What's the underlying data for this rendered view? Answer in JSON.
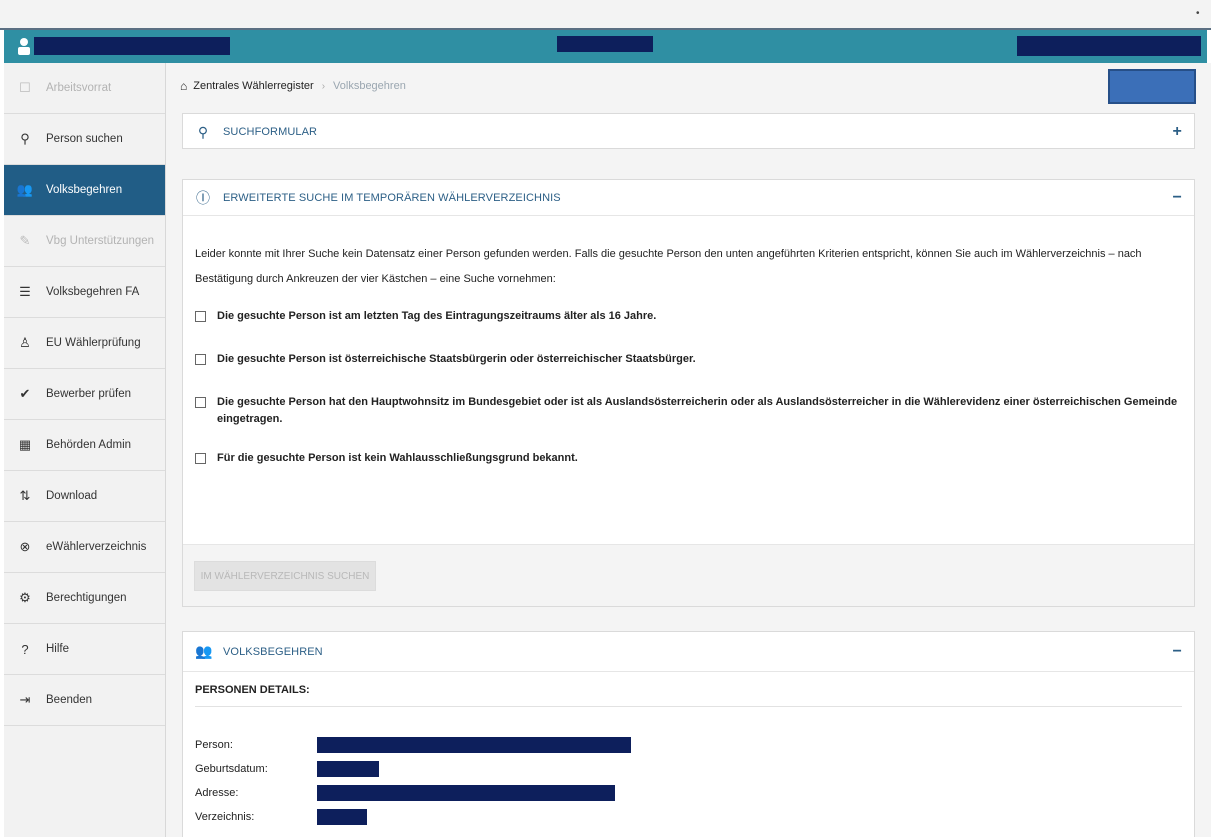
{
  "sidebar": {
    "items": [
      {
        "label": "Arbeitsvorrat",
        "icon": "inbox-icon",
        "glyph": "☐",
        "state": "disabled"
      },
      {
        "label": "Person suchen",
        "icon": "search-icon",
        "glyph": "⚲",
        "state": "normal"
      },
      {
        "label": "Volksbegehren",
        "icon": "petition-icon",
        "glyph": "👥",
        "state": "active"
      },
      {
        "label": "Vbg Unterstützungen",
        "icon": "pencil-icon",
        "glyph": "✎",
        "state": "disabled"
      },
      {
        "label": "Volksbegehren FA",
        "icon": "list-icon",
        "glyph": "☰",
        "state": "normal"
      },
      {
        "label": "EU Wählerprüfung",
        "icon": "person-icon",
        "glyph": "♙",
        "state": "normal"
      },
      {
        "label": "Bewerber prüfen",
        "icon": "check-circle-icon",
        "glyph": "✔",
        "state": "normal"
      },
      {
        "label": "Behörden Admin",
        "icon": "building-icon",
        "glyph": "▦",
        "state": "normal"
      },
      {
        "label": "Download",
        "icon": "download-icon",
        "glyph": "⇅",
        "state": "normal"
      },
      {
        "label": "eWählerverzeichnis",
        "icon": "cancel-circle-icon",
        "glyph": "⊗",
        "state": "normal"
      },
      {
        "label": "Berechtigungen",
        "icon": "gear-icon",
        "glyph": "⚙",
        "state": "normal"
      },
      {
        "label": "Hilfe",
        "icon": "help-icon",
        "glyph": "?",
        "state": "normal"
      },
      {
        "label": "Beenden",
        "icon": "exit-icon",
        "glyph": "⇥",
        "state": "normal"
      }
    ]
  },
  "breadcrumb": {
    "home": "Zentrales Wählerregister",
    "current": "Volksbegehren"
  },
  "search_panel": {
    "title": "SUCHFORMULAR",
    "toggle": "+"
  },
  "extended_panel": {
    "title": "ERWEITERTE SUCHE IM TEMPORÄREN WÄHLERVERZEICHNIS",
    "toggle": "−",
    "info_text": "Leider konnte mit Ihrer Suche kein Datensatz einer Person gefunden werden. Falls die gesuchte Person den unten angeführten Kriterien entspricht, können Sie auch im Wählerverzeichnis – nach Bestätigung durch Ankreuzen der vier Kästchen – eine Suche vornehmen:",
    "checkboxes": [
      "Die gesuchte Person ist am letzten Tag des Eintragungszeitraums älter als 16 Jahre.",
      "Die gesuchte Person ist österreichische Staatsbürgerin oder österreichischer Staatsbürger.",
      "Die gesuchte Person hat den Hauptwohnsitz im Bundesgebiet oder ist als Auslandsösterreicherin oder als Auslandsösterreicher in die Wählerevidenz einer österreichischen Gemeinde eingetragen.",
      "Für die gesuchte Person ist kein Wahlausschließungsgrund bekannt."
    ],
    "search_button": "IM WÄHLERVERZEICHNIS SUCHEN"
  },
  "volksbegehren_panel": {
    "title": "VOLKSBEGEHREN",
    "toggle": "−",
    "section_title": "PERSONEN DETAILS:",
    "labels": {
      "person": "Person:",
      "birthdate": "Geburtsdatum:",
      "address": "Adresse:",
      "directory": "Verzeichnis:"
    }
  },
  "colors": {
    "topbar": "#2f8fa3",
    "active_nav": "#215d86",
    "redaction": "#0d1f5c",
    "header_text": "#2c5f86"
  }
}
